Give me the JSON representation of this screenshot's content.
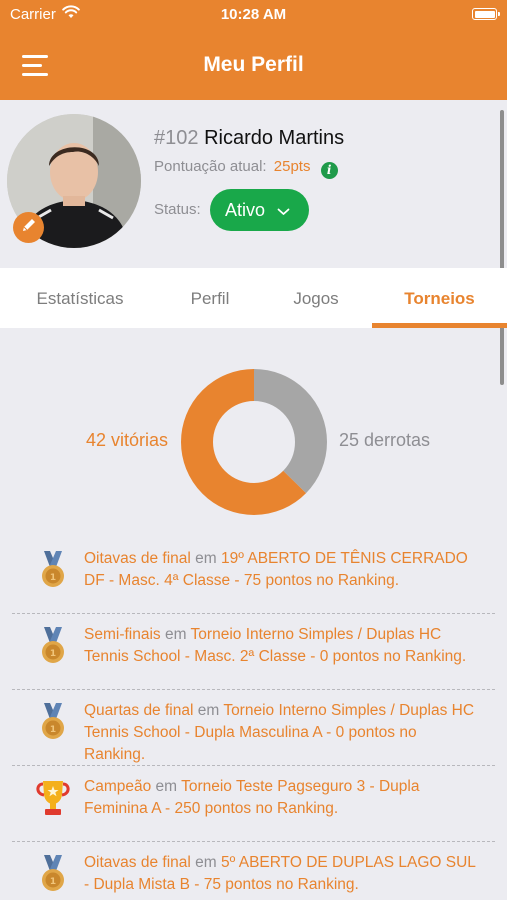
{
  "status_bar": {
    "carrier": "Carrier",
    "time": "10:28 AM"
  },
  "nav": {
    "title": "Meu Perfil"
  },
  "profile": {
    "rank": "#102",
    "name": "Ricardo Martins",
    "score_label": "Pontuação atual:",
    "score_value": "25pts",
    "status_label": "Status:",
    "status_value": "Ativo"
  },
  "tabs": [
    {
      "label": "Estatísticas"
    },
    {
      "label": "Perfil"
    },
    {
      "label": "Jogos"
    },
    {
      "label": "Torneios"
    }
  ],
  "active_tab": "Torneios",
  "chart_data": {
    "type": "pie",
    "categories": [
      "42 vitórias",
      "25 derrotas"
    ],
    "values": [
      42,
      25
    ],
    "colors": [
      "#e8842f",
      "#a6a6a6"
    ],
    "labels": {
      "wins": "42 vitórias",
      "losses": "25 derrotas"
    }
  },
  "tournaments": [
    {
      "icon": "medal-icon",
      "stage": "Oitavas de final",
      "connector": " em ",
      "event": "19º ABERTO DE TÊNIS CERRADO DF - Masc. 4ª Classe - 75 pontos no Ranking."
    },
    {
      "icon": "medal-icon",
      "stage": "Semi-finais",
      "connector": " em ",
      "event": "Torneio Interno Simples / Duplas HC Tennis School - Masc. 2ª Classe - 0 pontos no Ranking."
    },
    {
      "icon": "medal-icon",
      "stage": "Quartas de final",
      "connector": " em ",
      "event": "Torneio Interno Simples / Duplas HC Tennis School - Dupla Masculina A - 0 pontos no Ranking."
    },
    {
      "icon": "trophy-icon",
      "stage": "Campeão",
      "connector": " em ",
      "event": "Torneio Teste Pagseguro 3 - Dupla Feminina A - 250 pontos no Ranking."
    },
    {
      "icon": "medal-icon",
      "stage": "Oitavas de final",
      "connector": " em ",
      "event": "5º ABERTO DE DUPLAS LAGO SUL - Dupla Mista B - 75 pontos no Ranking."
    }
  ]
}
